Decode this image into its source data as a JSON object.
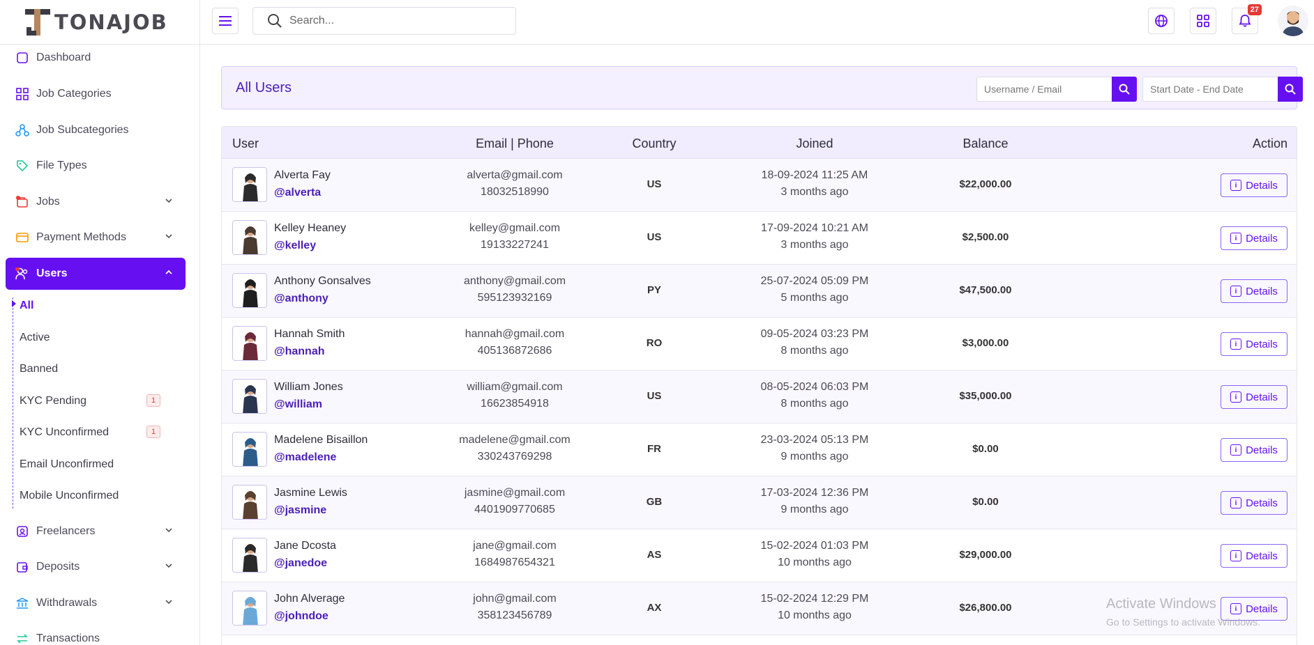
{
  "brand": {
    "logo_text": "TONAJOB"
  },
  "header": {
    "search_placeholder": "Search...",
    "notification_count": "27"
  },
  "sidebar": {
    "items": [
      {
        "label": "Dashboard",
        "icon": "dashboard-icon"
      },
      {
        "label": "Job Categories",
        "icon": "grid-icon"
      },
      {
        "label": "Job Subcategories",
        "icon": "sitemap-icon"
      },
      {
        "label": "File Types",
        "icon": "tag-icon"
      },
      {
        "label": "Jobs",
        "icon": "briefcase-icon"
      },
      {
        "label": "Payment Methods",
        "icon": "credit-card-icon"
      },
      {
        "label": "Users",
        "icon": "users-icon"
      },
      {
        "label": "Freelancers",
        "icon": "freelancer-icon"
      },
      {
        "label": "Deposits",
        "icon": "wallet-icon"
      },
      {
        "label": "Withdrawals",
        "icon": "bank-icon"
      },
      {
        "label": "Transactions",
        "icon": "transfer-icon"
      }
    ],
    "users_submenu": [
      {
        "label": "All",
        "badge": ""
      },
      {
        "label": "Active",
        "badge": ""
      },
      {
        "label": "Banned",
        "badge": ""
      },
      {
        "label": "KYC Pending",
        "badge": "1"
      },
      {
        "label": "KYC Unconfirmed",
        "badge": "1"
      },
      {
        "label": "Email Unconfirmed",
        "badge": ""
      },
      {
        "label": "Mobile Unconfirmed",
        "badge": ""
      }
    ]
  },
  "page": {
    "title": "All Users",
    "filter_user_placeholder": "Username / Email",
    "filter_date_placeholder": "Start Date - End Date"
  },
  "table": {
    "columns": [
      "User",
      "Email | Phone",
      "Country",
      "Joined",
      "Balance",
      "Action"
    ],
    "action_label": "Details",
    "rows": [
      {
        "name": "Alverta Fay",
        "handle": "@alverta",
        "email": "alverta@gmail.com",
        "phone": "18032518990",
        "country": "US",
        "joined": "18-09-2024 11:25 AM",
        "ago": "3 months ago",
        "balance": "$22,000.00"
      },
      {
        "name": "Kelley Heaney",
        "handle": "@kelley",
        "email": "kelley@gmail.com",
        "phone": "19133227241",
        "country": "US",
        "joined": "17-09-2024 10:21 AM",
        "ago": "3 months ago",
        "balance": "$2,500.00"
      },
      {
        "name": "Anthony Gonsalves",
        "handle": "@anthony",
        "email": "anthony@gmail.com",
        "phone": "595123932169",
        "country": "PY",
        "joined": "25-07-2024 05:09 PM",
        "ago": "5 months ago",
        "balance": "$47,500.00"
      },
      {
        "name": "Hannah Smith",
        "handle": "@hannah",
        "email": "hannah@gmail.com",
        "phone": "405136872686",
        "country": "RO",
        "joined": "09-05-2024 03:23 PM",
        "ago": "8 months ago",
        "balance": "$3,000.00"
      },
      {
        "name": "William Jones",
        "handle": "@william",
        "email": "william@gmail.com",
        "phone": "16623854918",
        "country": "US",
        "joined": "08-05-2024 06:03 PM",
        "ago": "8 months ago",
        "balance": "$35,000.00"
      },
      {
        "name": "Madelene Bisaillon",
        "handle": "@madelene",
        "email": "madelene@gmail.com",
        "phone": "330243769298",
        "country": "FR",
        "joined": "23-03-2024 05:13 PM",
        "ago": "9 months ago",
        "balance": "$0.00"
      },
      {
        "name": "Jasmine Lewis",
        "handle": "@jasmine",
        "email": "jasmine@gmail.com",
        "phone": "4401909770685",
        "country": "GB",
        "joined": "17-03-2024 12:36 PM",
        "ago": "9 months ago",
        "balance": "$0.00"
      },
      {
        "name": "Jane Dcosta",
        "handle": "@janedoe",
        "email": "jane@gmail.com",
        "phone": "1684987654321",
        "country": "AS",
        "joined": "15-02-2024 01:03 PM",
        "ago": "10 months ago",
        "balance": "$29,000.00"
      },
      {
        "name": "John Alverage",
        "handle": "@johndoe",
        "email": "john@gmail.com",
        "phone": "358123456789",
        "country": "AX",
        "joined": "15-02-2024 12:29 PM",
        "ago": "10 months ago",
        "balance": "$26,800.00"
      }
    ]
  },
  "watermark": {
    "line1": "Activate Windows",
    "line2": "Go to Settings to activate Windows."
  }
}
